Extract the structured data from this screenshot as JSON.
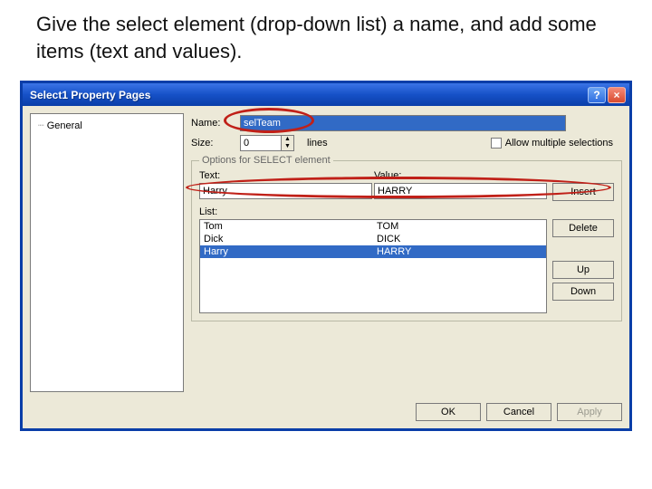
{
  "instruction": "Give the select element (drop-down list) a name, and add some items (text and values).",
  "window": {
    "title": "Select1 Property Pages",
    "help_icon": "?",
    "close_icon": "×"
  },
  "sidebar": {
    "items": [
      "General"
    ]
  },
  "fields": {
    "name_label": "Name:",
    "name_value": "selTeam",
    "size_label": "Size:",
    "size_value": "0",
    "lines_label": "lines",
    "allow_multi_label": "Allow multiple selections"
  },
  "group": {
    "title": "Options for SELECT element",
    "text_label": "Text:",
    "text_value": "Harry",
    "value_label": "Value:",
    "value_value": "HARRY",
    "insert_btn": "Insert",
    "list_label": "List:",
    "delete_btn": "Delete",
    "up_btn": "Up",
    "down_btn": "Down",
    "list": [
      {
        "text": "Tom",
        "value": "TOM",
        "selected": false
      },
      {
        "text": "Dick",
        "value": "DICK",
        "selected": false
      },
      {
        "text": "Harry",
        "value": "HARRY",
        "selected": true
      }
    ]
  },
  "footer": {
    "ok": "OK",
    "cancel": "Cancel",
    "apply": "Apply"
  }
}
